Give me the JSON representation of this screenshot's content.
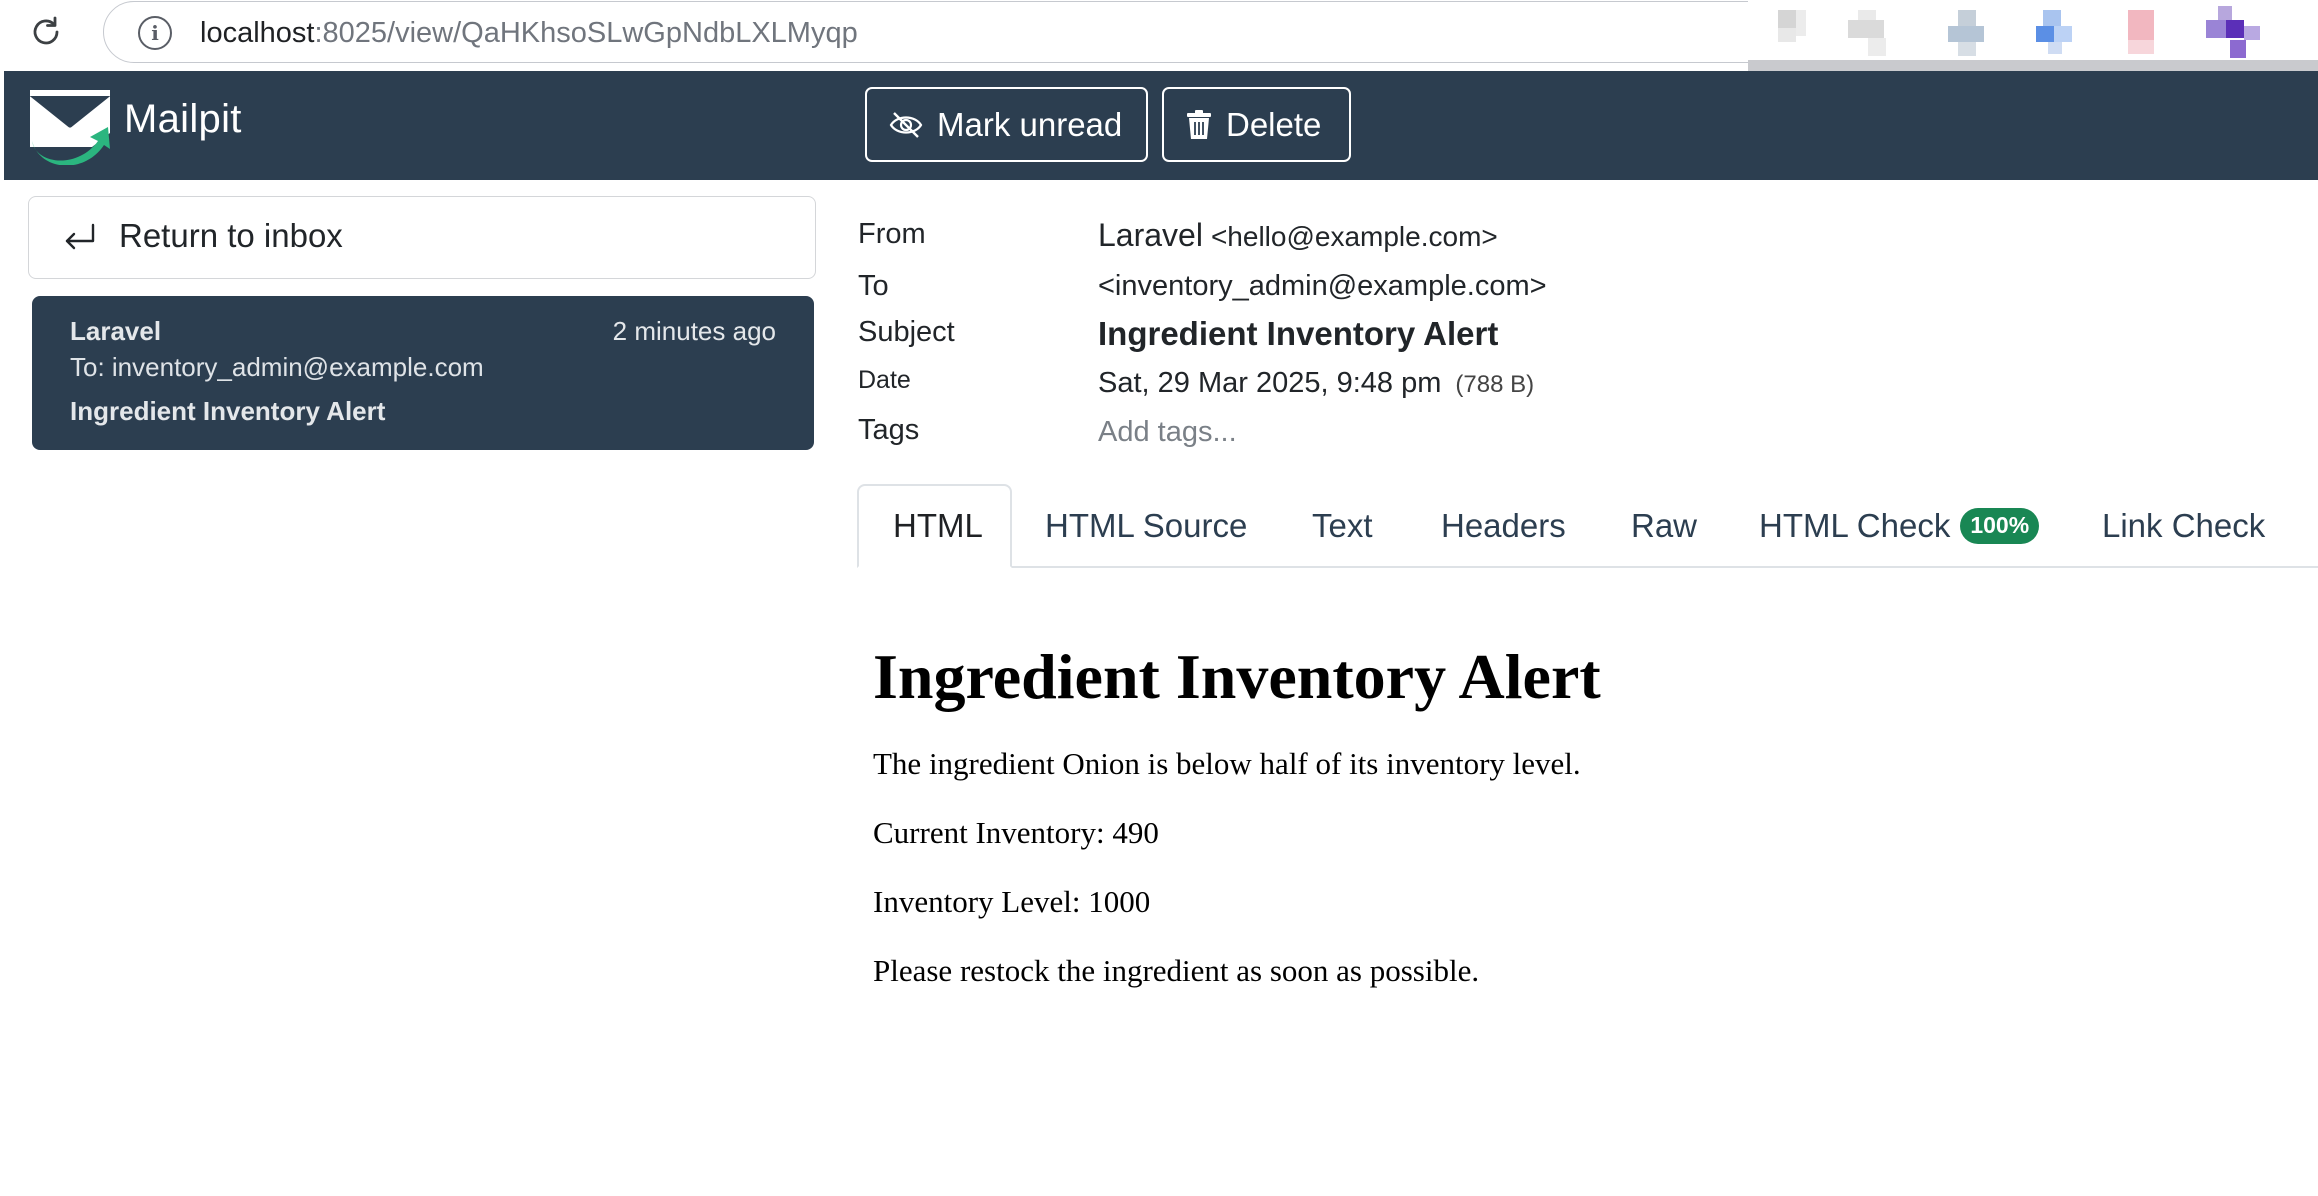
{
  "browser": {
    "url_host": "localhost",
    "url_path": ":8025/view/QaHKhsoSLwGpNdbLXLMyqp"
  },
  "app": {
    "brand": "Mailpit",
    "actions": {
      "mark_unread": "Mark unread",
      "delete": "Delete"
    }
  },
  "sidebar": {
    "return_label": "Return to inbox",
    "selected_message": {
      "from": "Laravel",
      "time": "2 minutes ago",
      "to": "To: inventory_admin@example.com",
      "subject": "Ingredient Inventory Alert"
    }
  },
  "message": {
    "labels": {
      "from": "From",
      "to": "To",
      "subject": "Subject",
      "date": "Date",
      "tags": "Tags"
    },
    "from_name": "Laravel",
    "from_email": "<hello@example.com>",
    "to": "<inventory_admin@example.com>",
    "subject": "Ingredient Inventory Alert",
    "date": "Sat, 29 Mar 2025, 9:48 pm",
    "size": "(788 B)",
    "tags_placeholder": "Add tags..."
  },
  "tabs": [
    {
      "label": "HTML",
      "active": true
    },
    {
      "label": "HTML Source"
    },
    {
      "label": "Text"
    },
    {
      "label": "Headers"
    },
    {
      "label": "Raw"
    },
    {
      "label": "HTML Check",
      "badge": "100%"
    },
    {
      "label": "Link Check"
    }
  ],
  "body": {
    "heading": "Ingredient Inventory Alert",
    "paragraphs": [
      "The ingredient Onion is below half of its inventory level.",
      "Current Inventory: 490",
      "Inventory Level: 1000",
      "Please restock the ingredient as soon as possible."
    ]
  },
  "colors": {
    "header_bg": "#2c3e50",
    "badge_green": "#198754",
    "logo_green": "#2bb57f"
  }
}
